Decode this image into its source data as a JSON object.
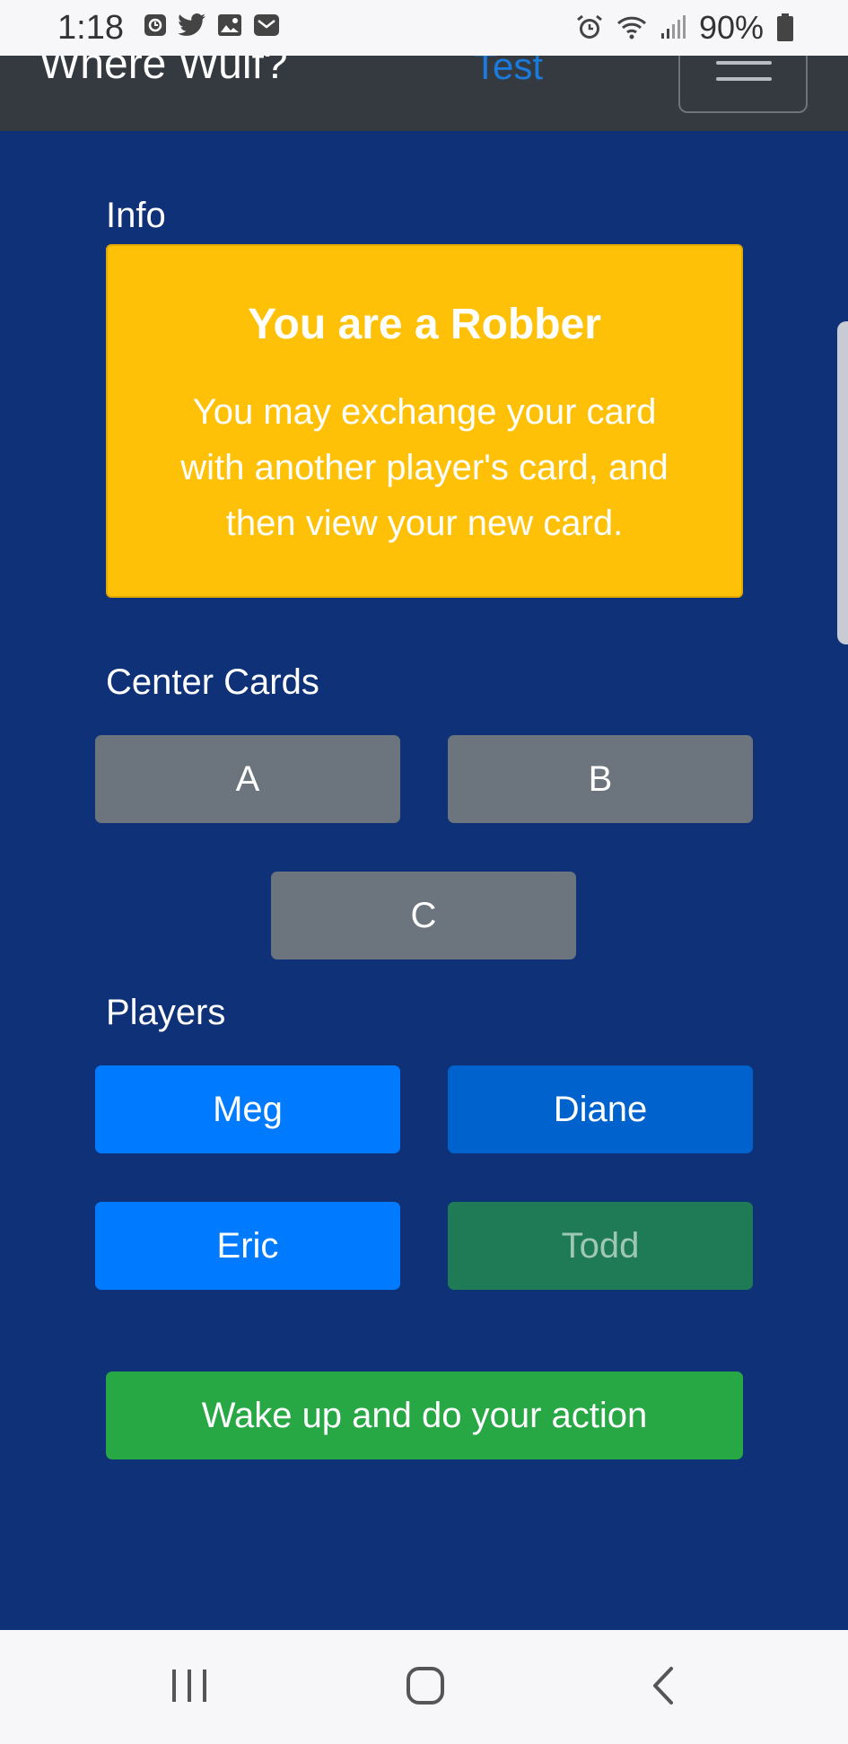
{
  "status_bar": {
    "time": "1:18",
    "battery": "90%",
    "left_icons": [
      "screenshot-icon",
      "twitter-icon",
      "gallery-icon",
      "mail-icon"
    ],
    "right_icons": [
      "alarm-icon",
      "wifi-icon",
      "signal-icon",
      "battery-icon"
    ]
  },
  "navbar": {
    "brand": "Where Wulf?",
    "link": "Test"
  },
  "info": {
    "label": "Info",
    "title": "You are a Robber",
    "text": "You may exchange your card with another player's card, and then view your new card."
  },
  "center_cards": {
    "label": "Center Cards",
    "cards": [
      "A",
      "B",
      "C"
    ]
  },
  "players": {
    "label": "Players",
    "names": [
      "Meg",
      "Diane",
      "Eric",
      "Todd"
    ]
  },
  "action_button": "Wake up and do your action",
  "colors": {
    "background": "#0e3178",
    "navbar": "#343a40",
    "info_card": "#ffc107",
    "card_gray": "#6c757d",
    "player_blue": "#007bff",
    "player_selected": "#0062cc",
    "player_disabled": "#1f7a56",
    "action_green": "#28a745"
  }
}
